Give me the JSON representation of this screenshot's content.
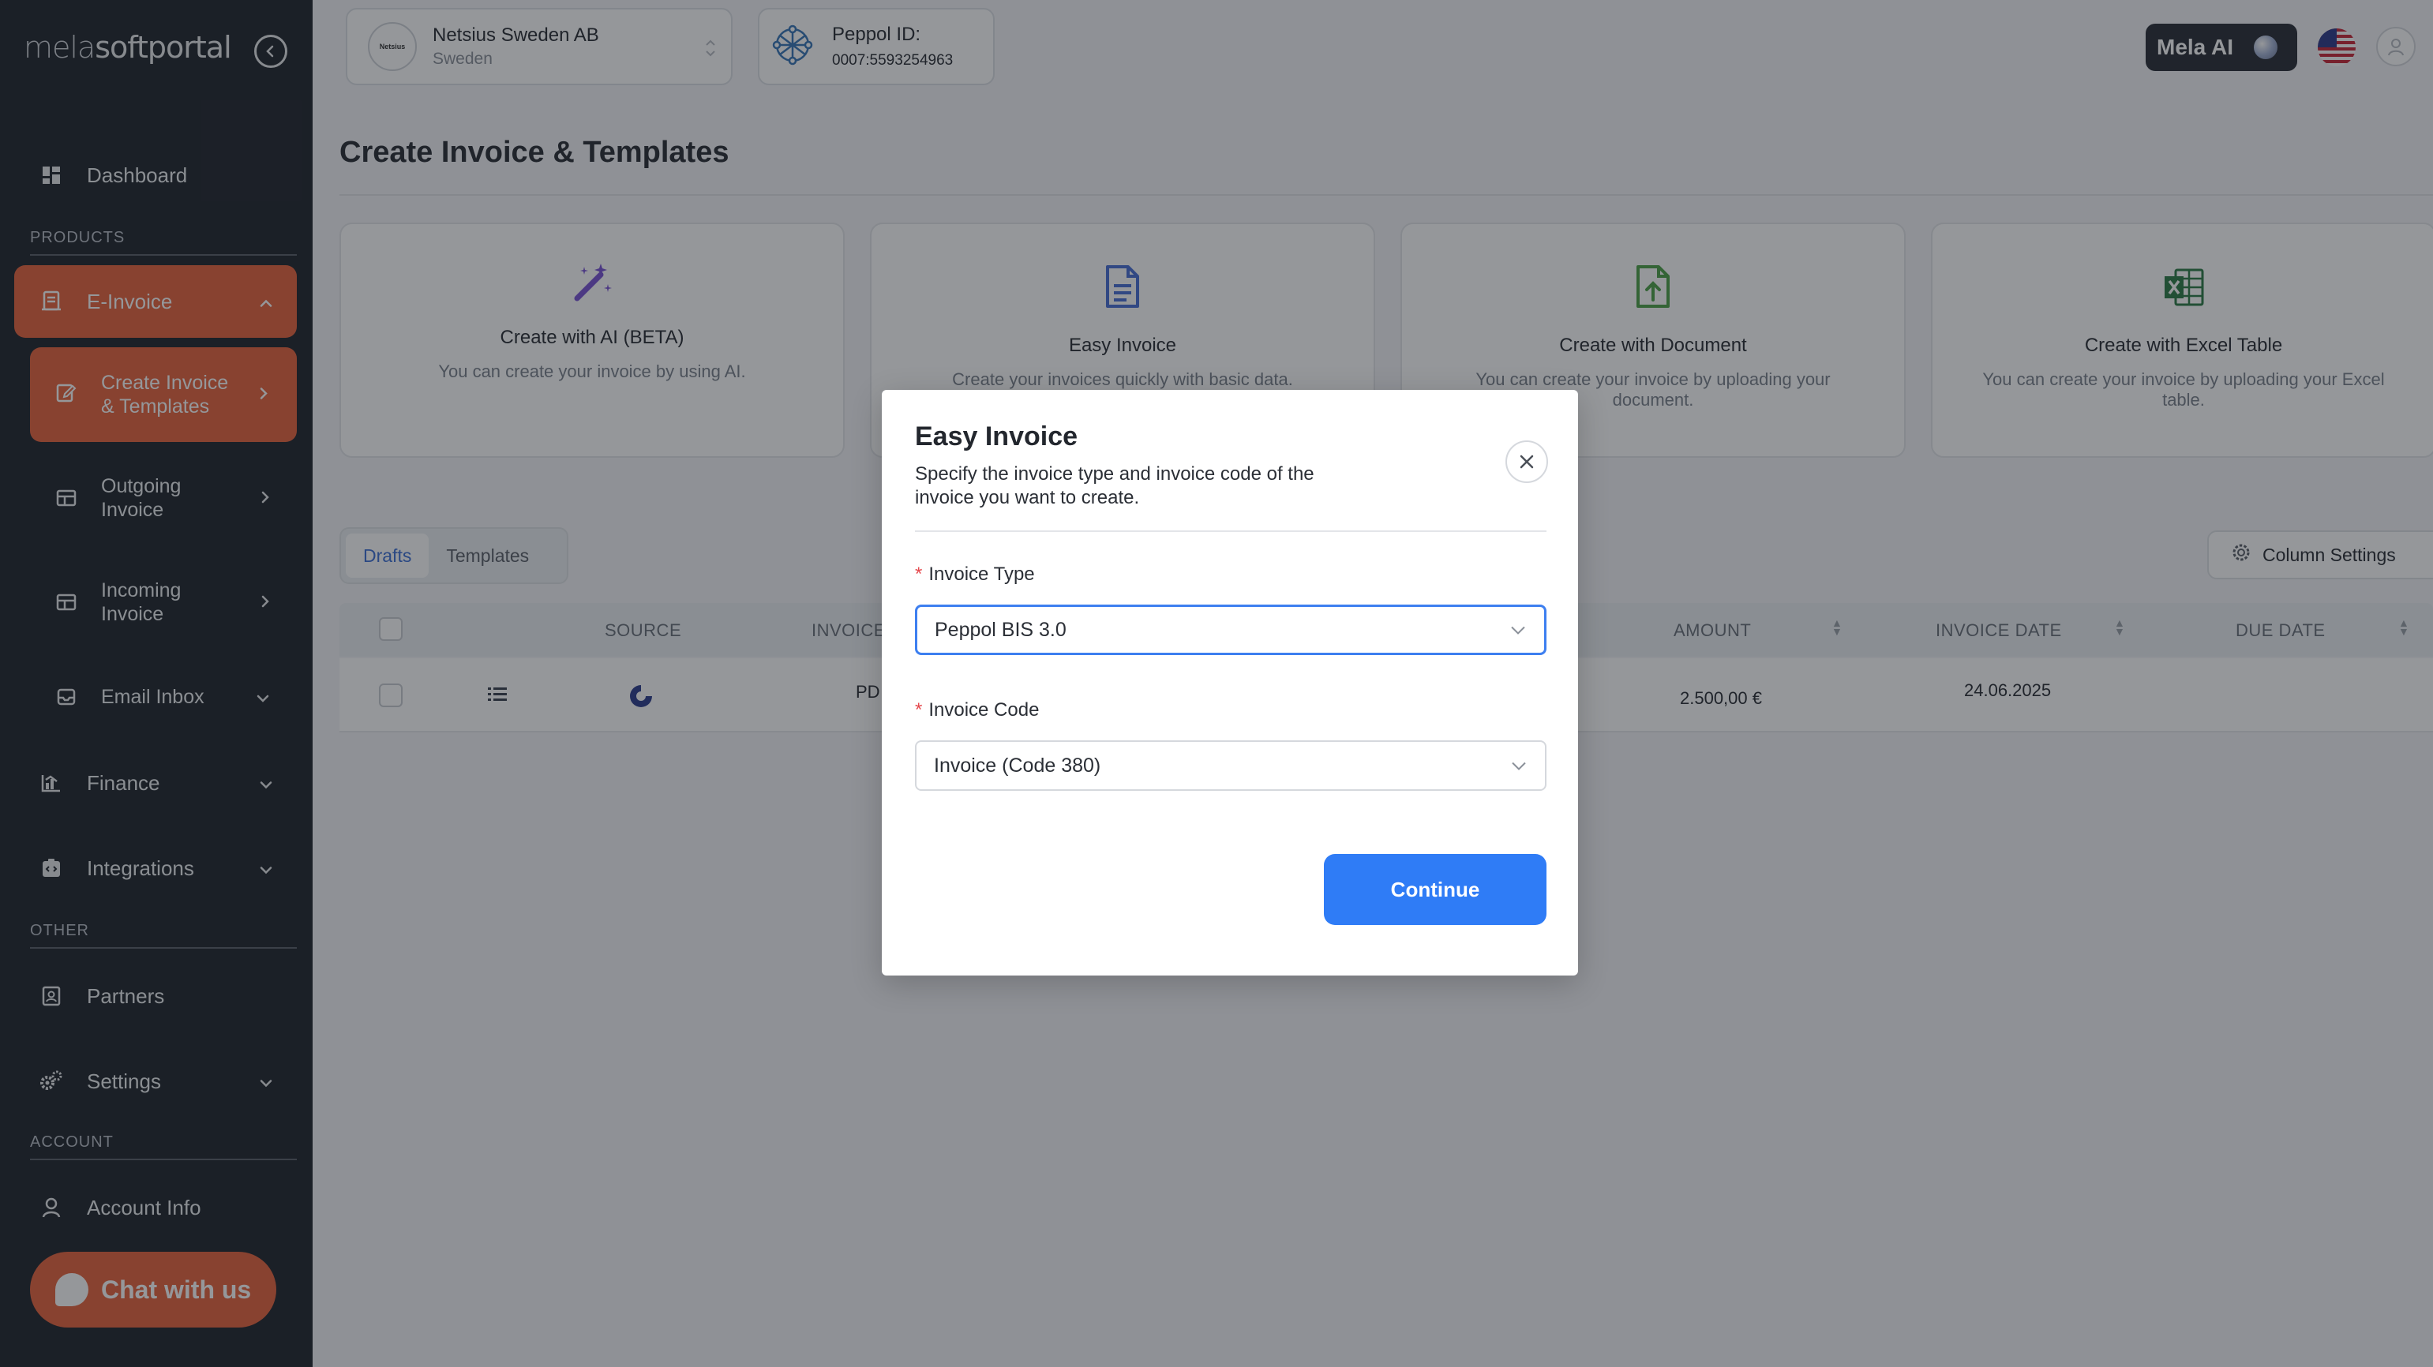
{
  "sidebar": {
    "logo_light": "mela",
    "logo_bold": "softportal",
    "dashboard": "Dashboard",
    "section_products": "PRODUCTS",
    "einvoice": "E-Invoice",
    "create_invoice_line1": "Create Invoice",
    "create_invoice_line2": "& Templates",
    "outgoing_line1": "Outgoing",
    "outgoing_line2": "Invoice",
    "incoming_line1": "Incoming",
    "incoming_line2": "Invoice",
    "email_inbox": "Email Inbox",
    "finance": "Finance",
    "integrations": "Integrations",
    "section_other": "OTHER",
    "partners": "Partners",
    "settings": "Settings",
    "section_account": "ACCOUNT",
    "account_info": "Account Info",
    "chat": "Chat with us"
  },
  "topbar": {
    "company_logo_text": "Netsius",
    "company_name": "Netsius Sweden AB",
    "company_country": "Sweden",
    "peppol_label": "Peppol ID:",
    "peppol_id": "0007:5593254963",
    "mela_ai": "Mela AI"
  },
  "main": {
    "title": "Create Invoice & Templates",
    "cards": [
      {
        "title": "Create with AI (BETA)",
        "desc": "You can create your invoice by using AI."
      },
      {
        "title": "Easy Invoice",
        "desc": "Create your invoices quickly with basic data."
      },
      {
        "title": "Create with Document",
        "desc": "You can create your invoice by uploading your document."
      },
      {
        "title": "Create with Excel Table",
        "desc": "You can create your invoice by uploading your Excel table."
      }
    ],
    "tabs": [
      "Drafts",
      "Templates"
    ],
    "column_settings": "Column Settings",
    "table": {
      "headers": {
        "source": "SOURCE",
        "invoice": "INVOICE",
        "amount": "AMOUNT",
        "invoice_date": "INVOICE DATE",
        "due_date": "DUE DATE"
      },
      "rows": [
        {
          "invoice": "PD",
          "amount": "2.500,00 €",
          "invoice_date": "24.06.2025"
        }
      ]
    }
  },
  "modal": {
    "title": "Easy Invoice",
    "subtitle": "Specify the invoice type and invoice code of the invoice you want to create.",
    "required_mark": "*",
    "invoice_type_label": "Invoice Type",
    "invoice_type_value": "Peppol BIS 3.0",
    "invoice_code_label": "Invoice Code",
    "invoice_code_value": "Invoice (Code 380)",
    "continue": "Continue"
  },
  "colors": {
    "accent_orange": "#e8643f",
    "primary_blue": "#2f7cf6",
    "sidebar_bg": "#22272f",
    "ai_purple": "#7b55d6",
    "doc_blue": "#4a6fd6",
    "doc_green": "#4fa34a",
    "excel_green": "#2f7d47"
  }
}
